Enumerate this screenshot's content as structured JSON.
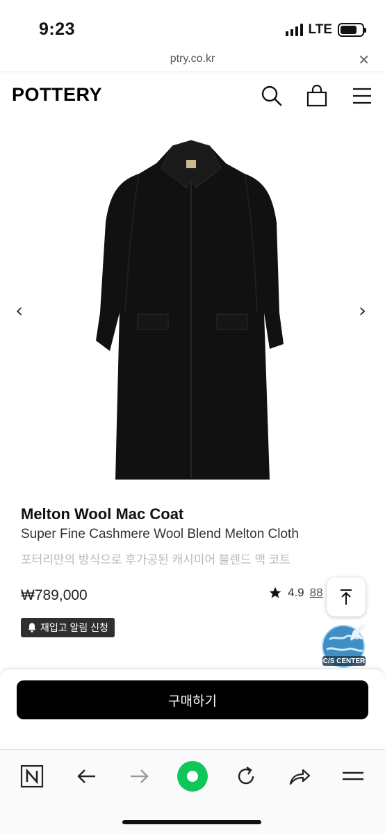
{
  "status": {
    "time": "9:23",
    "network": "LTE",
    "battery_level": 0.75
  },
  "browser": {
    "url": "ptry.co.kr",
    "close_glyph": "✕"
  },
  "header": {
    "logo": "POTTERY",
    "icons": [
      "search-icon",
      "shopping-bag-icon",
      "menu-icon"
    ]
  },
  "gallery": {
    "prev_glyph": "‹",
    "next_glyph": "›"
  },
  "product": {
    "name": "Melton Wool Mac Coat",
    "subtitle": "Super Fine Cashmere Wool Blend Melton Cloth",
    "korean_desc": "포터리만의 방식으로 후가공된 캐시미어 블렌드 맥 코트",
    "price": "₩789,000",
    "rating": "4.9",
    "review_count": "88",
    "restock_label": "재입고 알림 신청"
  },
  "floating": {
    "cs_center_label": "C/S CENTER"
  },
  "purchase": {
    "buy_label": "구매하기"
  },
  "toolbar": {
    "items": [
      "naver-n-icon",
      "back-icon",
      "forward-icon",
      "home-green-icon",
      "refresh-icon",
      "share-icon",
      "menu-lines-icon"
    ]
  },
  "colors": {
    "accent_green": "#11c659",
    "buy_button": "#000000",
    "coat": "#111111"
  }
}
